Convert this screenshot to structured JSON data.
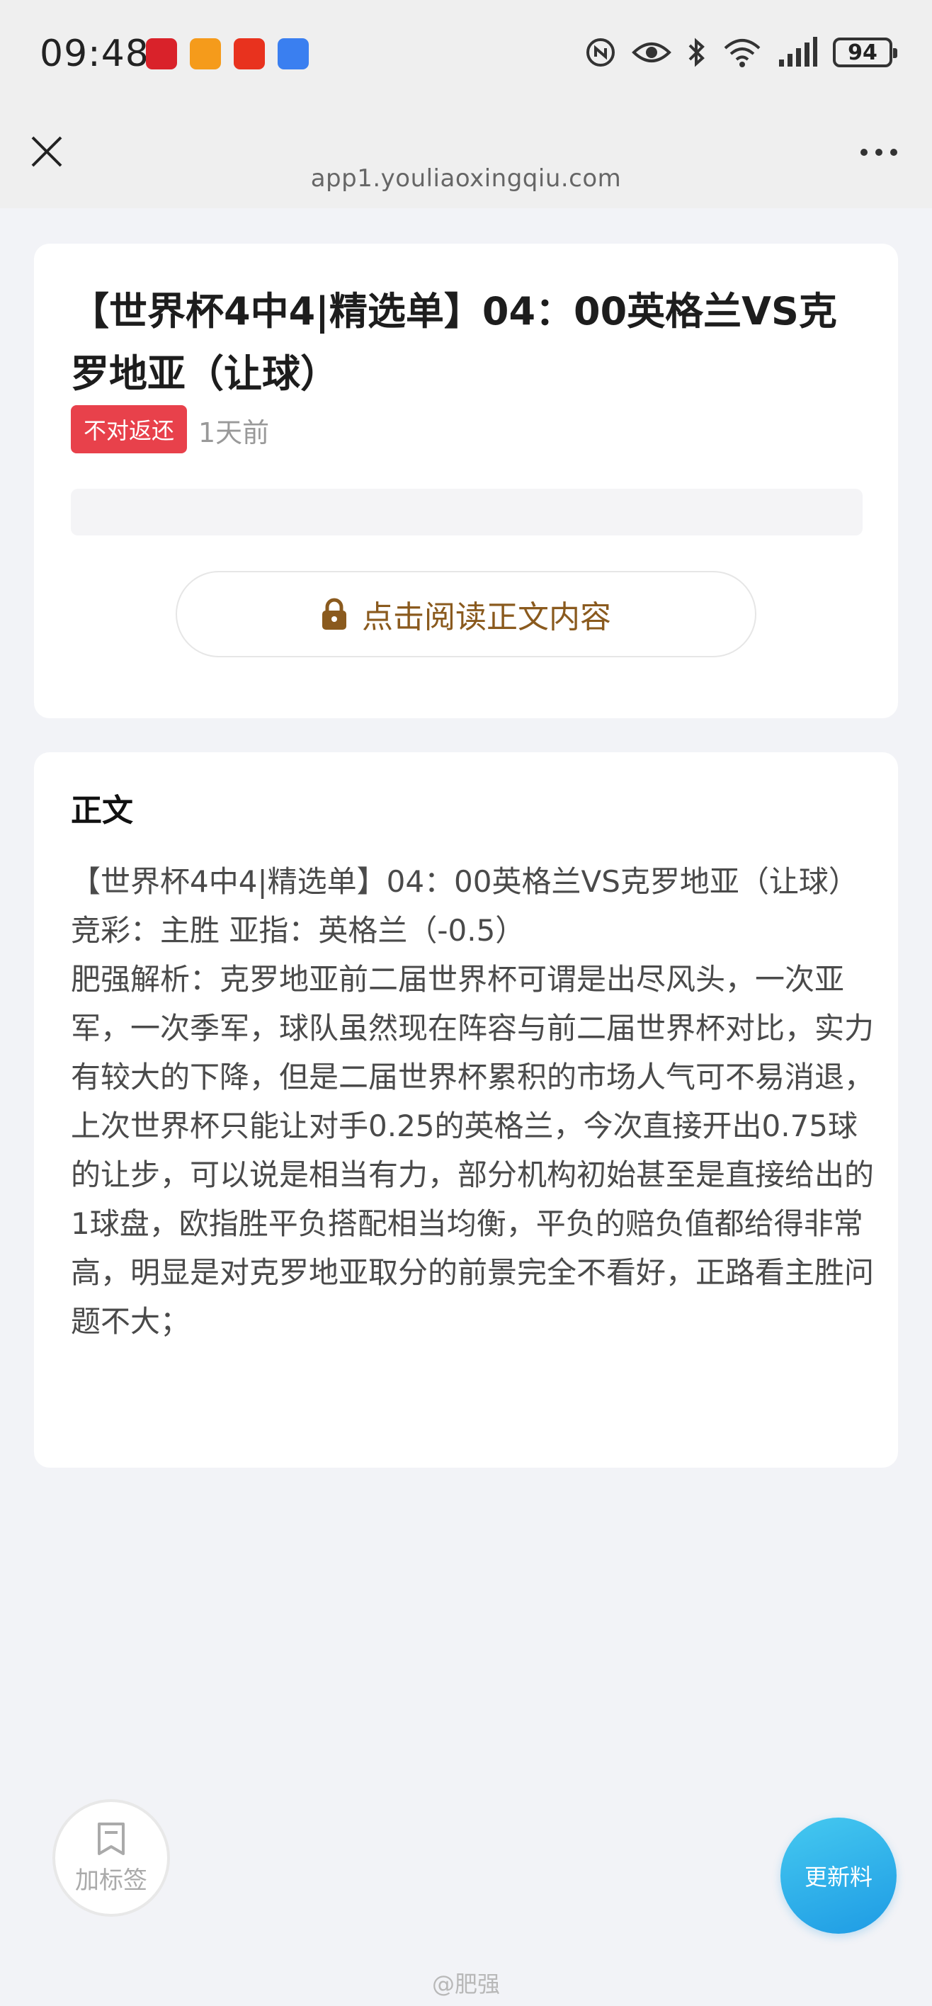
{
  "status_bar": {
    "time": "09:48",
    "battery": "94",
    "app_icons": [
      "tmall-app-icon",
      "orange-app-icon",
      "pingan-bank-app-icon",
      "blue-app-icon"
    ],
    "system_icons": [
      "nfc-icon",
      "eye-icon",
      "bluetooth-icon",
      "wifi-icon",
      "signal-icon",
      "battery-icon"
    ]
  },
  "nav": {
    "url": "app1.youliaoxingqiu.com"
  },
  "article": {
    "title": "【世界杯4中4|精选单】04：00英格兰VS克罗地亚（让球）",
    "badge": "不对返还",
    "time_ago": "1天前",
    "read_button": "点击阅读正文内容"
  },
  "content": {
    "section_title": "正文",
    "paragraphs": [
      "【世界杯4中4|精选单】04：00英格兰VS克罗地亚（让球）",
      "竞彩：主胜 亚指：英格兰（-0.5）",
      "肥强解析：克罗地亚前二届世界杯可谓是出尽风头，一次亚军，一次季军，球队虽然现在阵容与前二届世界杯对比，实力有较大的下降，但是二届世界杯累积的市场人气可不易消退，上次世界杯只能让对手0.25的英格兰，今次直接开出0.75球的让步，可以说是相当有力，部分机构初始甚至是直接给出的1球盘，欧指胜平负搭配相当均衡，平负的赔负值都给得非常高，明显是对克罗地亚取分的前景完全不看好，正路看主胜问题不大；"
    ]
  },
  "floating": {
    "bookmark_label": "加标签",
    "update_label": "更新料"
  },
  "watermark": "@肥强",
  "colors": {
    "badge": "#e8414b",
    "read_button_text": "#8a5a1e",
    "update_button": "#1e9be4"
  }
}
